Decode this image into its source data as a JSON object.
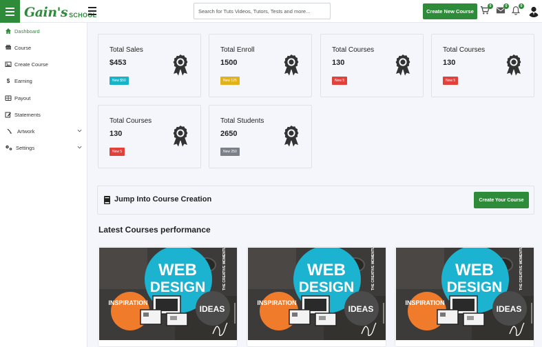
{
  "brand": {
    "logo_main": "Gain's",
    "logo_sub": "SCHOOL",
    "accent": "#2e8b3a"
  },
  "search": {
    "placeholder": "Search for Tuts Videos, Tutors, Tests and more..."
  },
  "header": {
    "create_new_course": "Create New Course",
    "cart_badge": "0",
    "mail_badge": "0",
    "bell_badge": "0"
  },
  "sidebar": {
    "items": [
      {
        "label": "Dashboard",
        "icon": "home-icon"
      },
      {
        "label": "Course",
        "icon": "books-icon"
      },
      {
        "label": "Create Course",
        "icon": "image-icon"
      },
      {
        "label": "Earning",
        "icon": "dollar-icon"
      },
      {
        "label": "Payout",
        "icon": "wallet-icon"
      },
      {
        "label": "Statements",
        "icon": "edit-icon"
      },
      {
        "label": "Artwork",
        "icon": "brush-icon"
      },
      {
        "label": "Settings",
        "icon": "gears-icon"
      }
    ]
  },
  "stats": [
    {
      "title": "Total Sales",
      "value": "$453",
      "badge": "New $50",
      "badge_color": "#17b3c9"
    },
    {
      "title": "Total Enroll",
      "value": "1500",
      "badge": "New 125",
      "badge_color": "#e0b21b"
    },
    {
      "title": "Total Courses",
      "value": "130",
      "badge": "New 5",
      "badge_color": "#e2403b"
    },
    {
      "title": "Total Courses",
      "value": "130",
      "badge": "New 5",
      "badge_color": "#e2403b"
    },
    {
      "title": "Total Courses",
      "value": "130",
      "badge": "New 5",
      "badge_color": "#e2403b"
    },
    {
      "title": "Total Students",
      "value": "2650",
      "badge": "New 250",
      "badge_color": "#7b8089"
    }
  ],
  "jump": {
    "title": "Jump Into Course Creation",
    "button": "Create Your Course"
  },
  "latest": {
    "title": "Latest Courses performance",
    "thumbnail": {
      "line1": "WEB",
      "line2": "DESIGN",
      "left": "INSPIRATION",
      "right": "IDEAS",
      "side": "THE CREATIVE MOMENTUM"
    }
  }
}
